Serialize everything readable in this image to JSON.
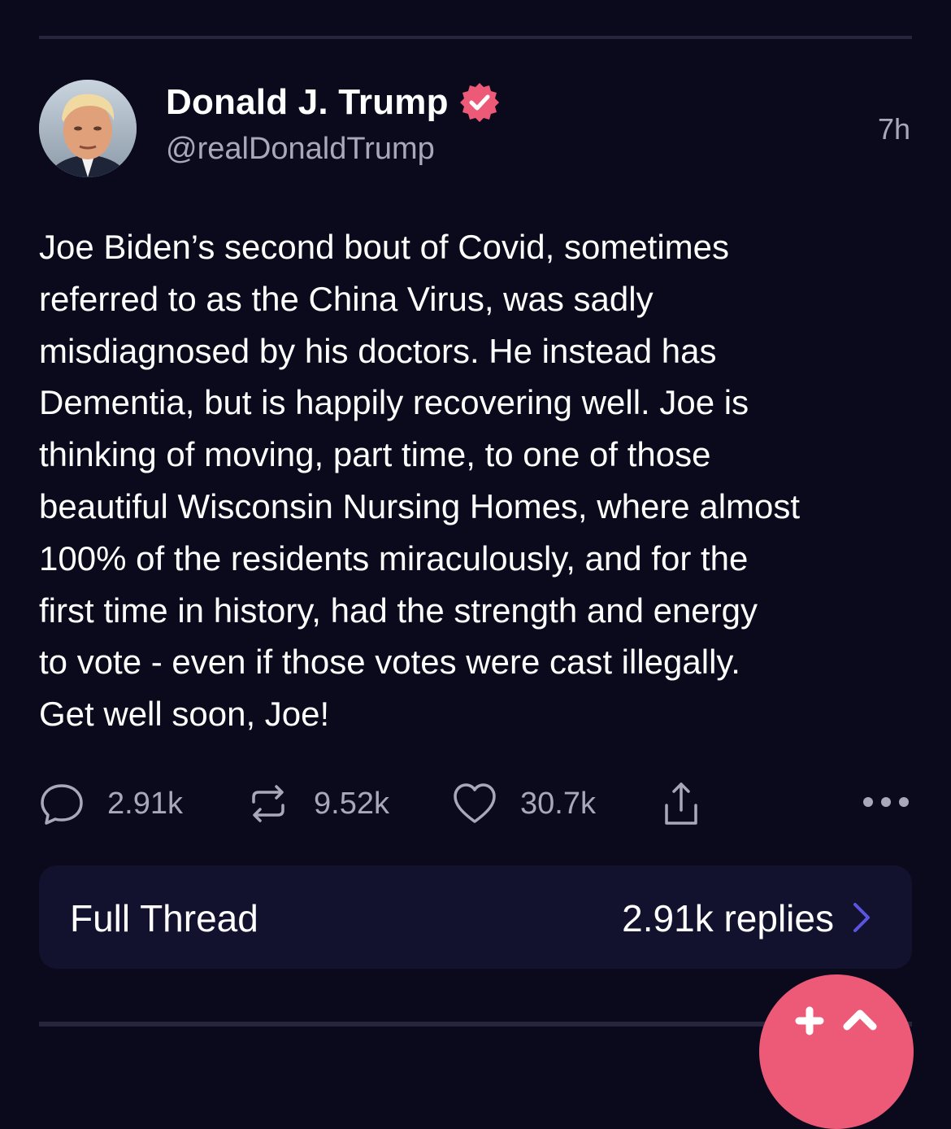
{
  "post": {
    "author": {
      "display_name": "Donald J. Trump",
      "handle": "@realDonaldTrump",
      "verified": true,
      "avatar_icon": "profile-photo"
    },
    "timestamp": "7h",
    "body_lines": [
      "Joe Biden’s second bout of Covid, sometimes",
      "referred to as the China Virus, was sadly",
      "misdiagnosed by his doctors. He instead has",
      "Dementia, but is happily recovering well. Joe is",
      "thinking of moving, part time, to one of those",
      "beautiful Wisconsin Nursing Homes, where almost",
      "100% of the residents miraculously, and for the",
      "first time in history, had the strength and energy",
      "to vote - even if those votes were cast illegally.",
      "Get well soon, Joe!"
    ],
    "actions": {
      "replies": "2.91k",
      "reposts": "9.52k",
      "likes": "30.7k",
      "share_icon": "share-icon",
      "more_icon": "more-icon"
    }
  },
  "thread_bar": {
    "label": "Full Thread",
    "replies": "2.91k replies"
  },
  "colors": {
    "background": "#0b0a1c",
    "thread_bar": "#13122e",
    "muted_text": "#a9a8b8",
    "verified_badge": "#ed5a78",
    "fab": "#ed5a78",
    "chevron": "#5a54e0"
  }
}
